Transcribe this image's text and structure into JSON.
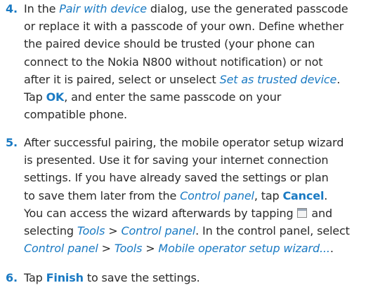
{
  "colors": {
    "accent": "#1a7ac3",
    "text": "#2b2b2b"
  },
  "steps": [
    {
      "number": "4.",
      "lines": [
        [
          "In the ",
          "Pair with device",
          " dialog, use the generated passcode"
        ],
        [
          "or replace it with a passcode of your own. Define whether"
        ],
        [
          "the paired device should be trusted (your phone can"
        ],
        [
          "connect to the Nokia N800 without notification) or not"
        ],
        [
          "after it is paired, select or unselect ",
          "Set as trusted device",
          "."
        ],
        [
          "Tap ",
          "OK",
          ", and enter the same passcode on your"
        ],
        [
          "compatible phone."
        ]
      ]
    },
    {
      "number": "5.",
      "lines": [
        [
          "After successful pairing, the mobile operator setup wizard"
        ],
        [
          "is presented. Use it for saving your internet connection"
        ],
        [
          "settings. If you have already saved the settings or plan"
        ],
        [
          "to save them later from the ",
          "Control panel",
          ", tap ",
          "Cancel",
          "."
        ],
        [
          "You can access the wizard afterwards by tapping ",
          "and"
        ],
        [
          "selecting ",
          "Tools",
          " > ",
          "Control panel",
          ". In the control panel, select"
        ],
        [
          "Control panel",
          " > ",
          "Tools",
          " > ",
          "Mobile operator setup wizard...",
          "."
        ]
      ],
      "icon": "menu-window-icon"
    },
    {
      "number": "6.",
      "lines": [
        [
          "Tap ",
          "Finish",
          " to save the settings."
        ]
      ]
    }
  ]
}
